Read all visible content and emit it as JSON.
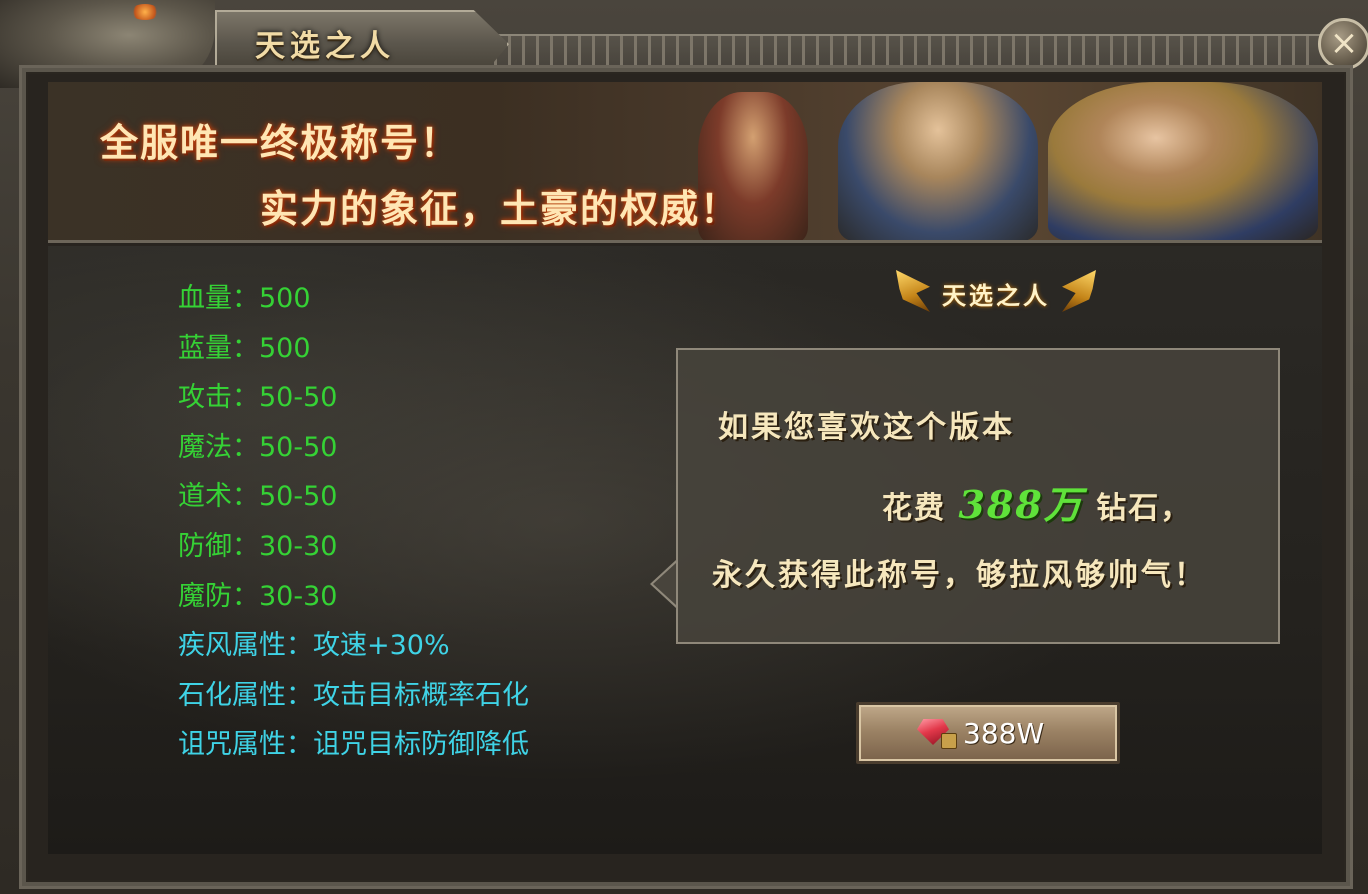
{
  "window": {
    "title": "天选之人",
    "close_label": "×"
  },
  "banner": {
    "line1": "全服唯一终极称号！",
    "line2": "实力的象征，土豪的权威！"
  },
  "stats": [
    {
      "text": "血量：500",
      "color": "#35d235"
    },
    {
      "text": "蓝量：500",
      "color": "#35d235"
    },
    {
      "text": "攻击：50-50",
      "color": "#35d235"
    },
    {
      "text": "魔法：50-50",
      "color": "#35d235"
    },
    {
      "text": "道术：50-50",
      "color": "#35d235"
    },
    {
      "text": "防御：30-30",
      "color": "#35d235"
    },
    {
      "text": "魔防：30-30",
      "color": "#35d235"
    },
    {
      "text": "疾风属性：攻速+30%",
      "color": "#3fd3e6"
    },
    {
      "text": "石化属性：攻击目标概率石化",
      "color": "#3fd3e6"
    },
    {
      "text": "诅咒属性：诅咒目标防御降低",
      "color": "#3fd3e6"
    }
  ],
  "badge": {
    "label": "天选之人"
  },
  "bubble": {
    "line1": "如果您喜欢这个版本",
    "line2_prefix": "花费",
    "line2_price": "388万",
    "line2_suffix": "钻石，",
    "line3": "永久获得此称号，够拉风够帅气！"
  },
  "buy_button": {
    "label": "388W",
    "icon": "diamond-icon"
  },
  "colors": {
    "stat_green": "#35d235",
    "stat_cyan": "#3fd3e6",
    "price_green": "#5fe23a",
    "banner_text": "#ffe6b4"
  }
}
